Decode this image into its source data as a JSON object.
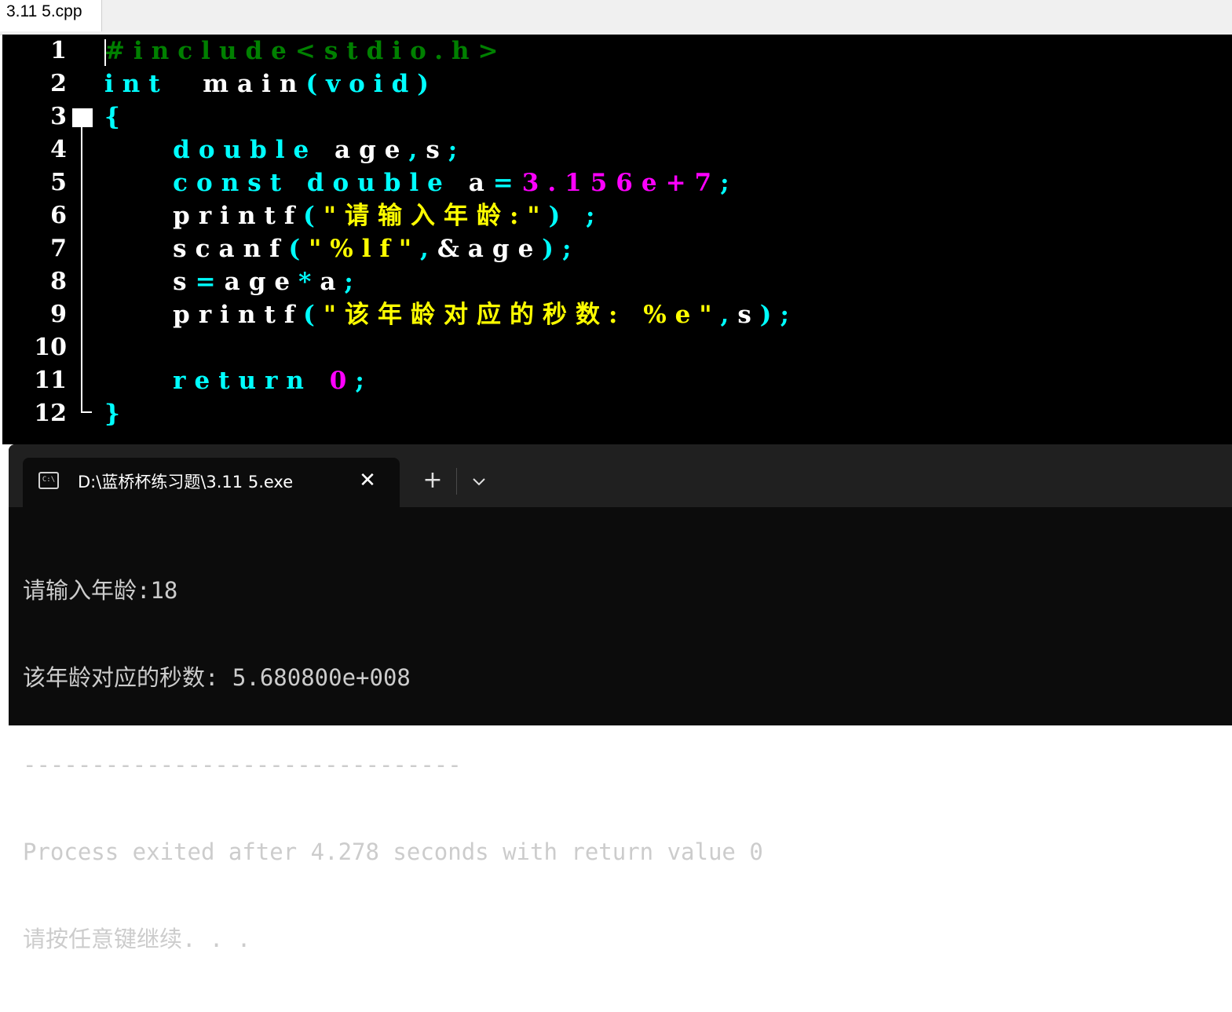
{
  "editor": {
    "tab_label": "3.11 5.cpp",
    "colors": {
      "background": "#000000",
      "preprocessor": "#008000",
      "keyword": "#00ffff",
      "identifier": "#ffffff",
      "number": "#ff00ff",
      "string": "#ffff00"
    },
    "lines": [
      {
        "num": "1",
        "tokens": [
          {
            "t": "#include<stdio.h>",
            "c": "pre"
          }
        ]
      },
      {
        "num": "2",
        "tokens": [
          {
            "t": "int",
            "c": "kw"
          },
          {
            "t": "  main",
            "c": "pl"
          },
          {
            "t": "(",
            "c": "sym"
          },
          {
            "t": "void",
            "c": "kw"
          },
          {
            "t": ")",
            "c": "sym"
          }
        ]
      },
      {
        "num": "3",
        "tokens": [
          {
            "t": "{",
            "c": "sym"
          }
        ]
      },
      {
        "num": "4",
        "tokens": [
          {
            "t": "    ",
            "c": "pl"
          },
          {
            "t": "double",
            "c": "kw"
          },
          {
            "t": " age",
            "c": "pl"
          },
          {
            "t": ",",
            "c": "sym"
          },
          {
            "t": "s",
            "c": "pl"
          },
          {
            "t": ";",
            "c": "sym"
          }
        ]
      },
      {
        "num": "5",
        "tokens": [
          {
            "t": "    ",
            "c": "pl"
          },
          {
            "t": "const double",
            "c": "kw"
          },
          {
            "t": " a",
            "c": "pl"
          },
          {
            "t": "=",
            "c": "sym"
          },
          {
            "t": "3.156e+7",
            "c": "num"
          },
          {
            "t": ";",
            "c": "sym"
          }
        ]
      },
      {
        "num": "6",
        "tokens": [
          {
            "t": "    ",
            "c": "pl"
          },
          {
            "t": "printf",
            "c": "pl"
          },
          {
            "t": "(",
            "c": "sym"
          },
          {
            "t": "\"请输入年龄:\"",
            "c": "str"
          },
          {
            "t": ") ;",
            "c": "sym"
          }
        ]
      },
      {
        "num": "7",
        "tokens": [
          {
            "t": "    ",
            "c": "pl"
          },
          {
            "t": "scanf",
            "c": "pl"
          },
          {
            "t": "(",
            "c": "sym"
          },
          {
            "t": "\"%lf\"",
            "c": "str"
          },
          {
            "t": ",",
            "c": "sym"
          },
          {
            "t": "&age",
            "c": "pl"
          },
          {
            "t": ");",
            "c": "sym"
          }
        ]
      },
      {
        "num": "8",
        "tokens": [
          {
            "t": "    ",
            "c": "pl"
          },
          {
            "t": "s",
            "c": "pl"
          },
          {
            "t": "=",
            "c": "sym"
          },
          {
            "t": "age",
            "c": "pl"
          },
          {
            "t": "*",
            "c": "sym"
          },
          {
            "t": "a",
            "c": "pl"
          },
          {
            "t": ";",
            "c": "sym"
          }
        ]
      },
      {
        "num": "9",
        "tokens": [
          {
            "t": "    ",
            "c": "pl"
          },
          {
            "t": "printf",
            "c": "pl"
          },
          {
            "t": "(",
            "c": "sym"
          },
          {
            "t": "\"该年龄对应的秒数: %e\"",
            "c": "str"
          },
          {
            "t": ",",
            "c": "sym"
          },
          {
            "t": "s",
            "c": "pl"
          },
          {
            "t": ");",
            "c": "sym"
          }
        ]
      },
      {
        "num": "10",
        "tokens": []
      },
      {
        "num": "11",
        "tokens": [
          {
            "t": "    ",
            "c": "pl"
          },
          {
            "t": "return",
            "c": "kw"
          },
          {
            "t": " ",
            "c": "pl"
          },
          {
            "t": "0",
            "c": "num"
          },
          {
            "t": ";",
            "c": "sym"
          }
        ]
      },
      {
        "num": "12",
        "tokens": [
          {
            "t": "}",
            "c": "sym"
          }
        ]
      }
    ]
  },
  "terminal": {
    "tab_icon": "C:\\",
    "tab_title": "D:\\蓝桥杯练习题\\3.11 5.exe",
    "close_symbol": "✕",
    "new_tab_symbol": "+",
    "output_lines": [
      "请输入年龄:18",
      "该年龄对应的秒数: 5.680800e+008",
      "--------------------------------",
      "Process exited after 4.278 seconds with return value 0",
      "请按任意键继续. . ."
    ]
  }
}
